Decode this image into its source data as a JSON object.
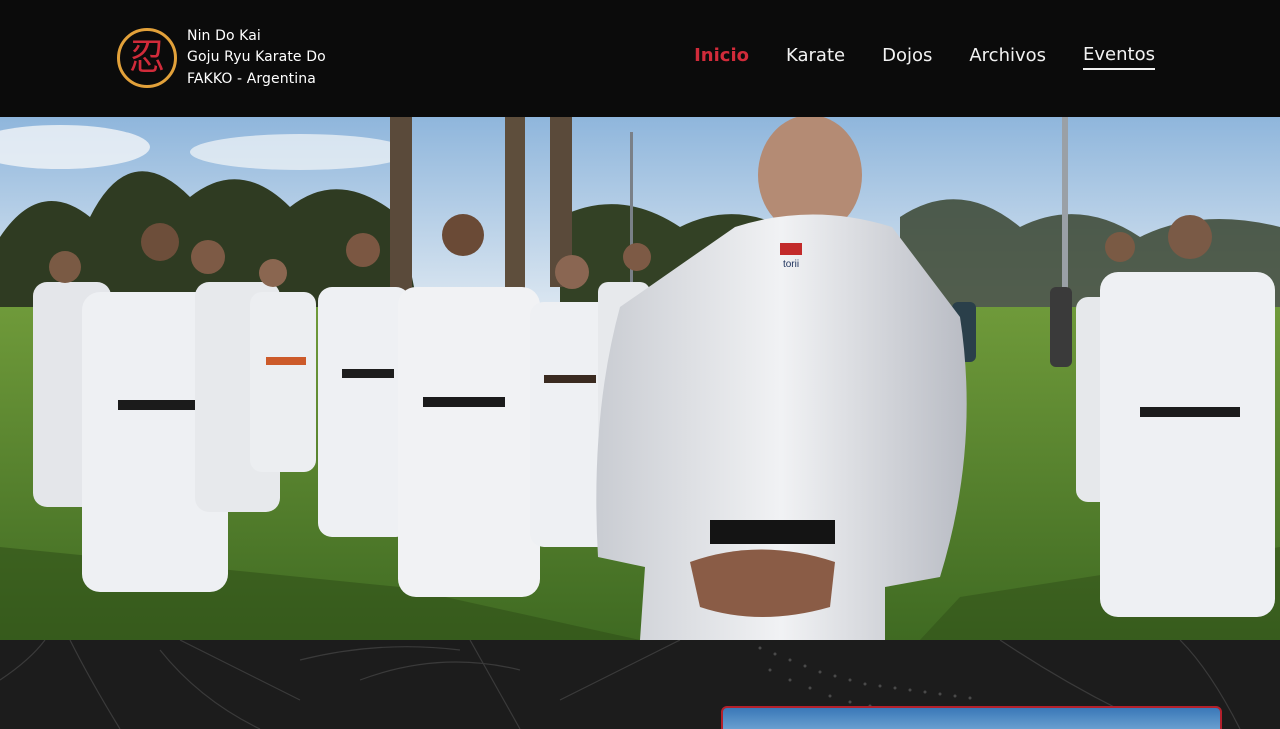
{
  "header": {
    "brand": {
      "lines": [
        "Nin Do Kai",
        "Goju Ryu Karate Do",
        "FAKKO - Argentina"
      ],
      "logo_icon": "shinobi-kanji-logo-icon",
      "logo_glyph": "忍",
      "logo_ring_color": "#e2a13a",
      "logo_glyph_color": "#d12b3a"
    },
    "nav": [
      {
        "label": "Inicio",
        "active": true
      },
      {
        "label": "Karate"
      },
      {
        "label": "Dojos"
      },
      {
        "label": "Archivos"
      },
      {
        "label": "Eventos",
        "underlined": true
      }
    ],
    "accent_color": "#d12b3a"
  },
  "hero": {
    "image": "karate-group-outdoor-photo",
    "gi_patch_text": "torii"
  },
  "lower": {
    "pattern": "crane-and-dots-line-art",
    "card_border_color": "#b3202c"
  }
}
